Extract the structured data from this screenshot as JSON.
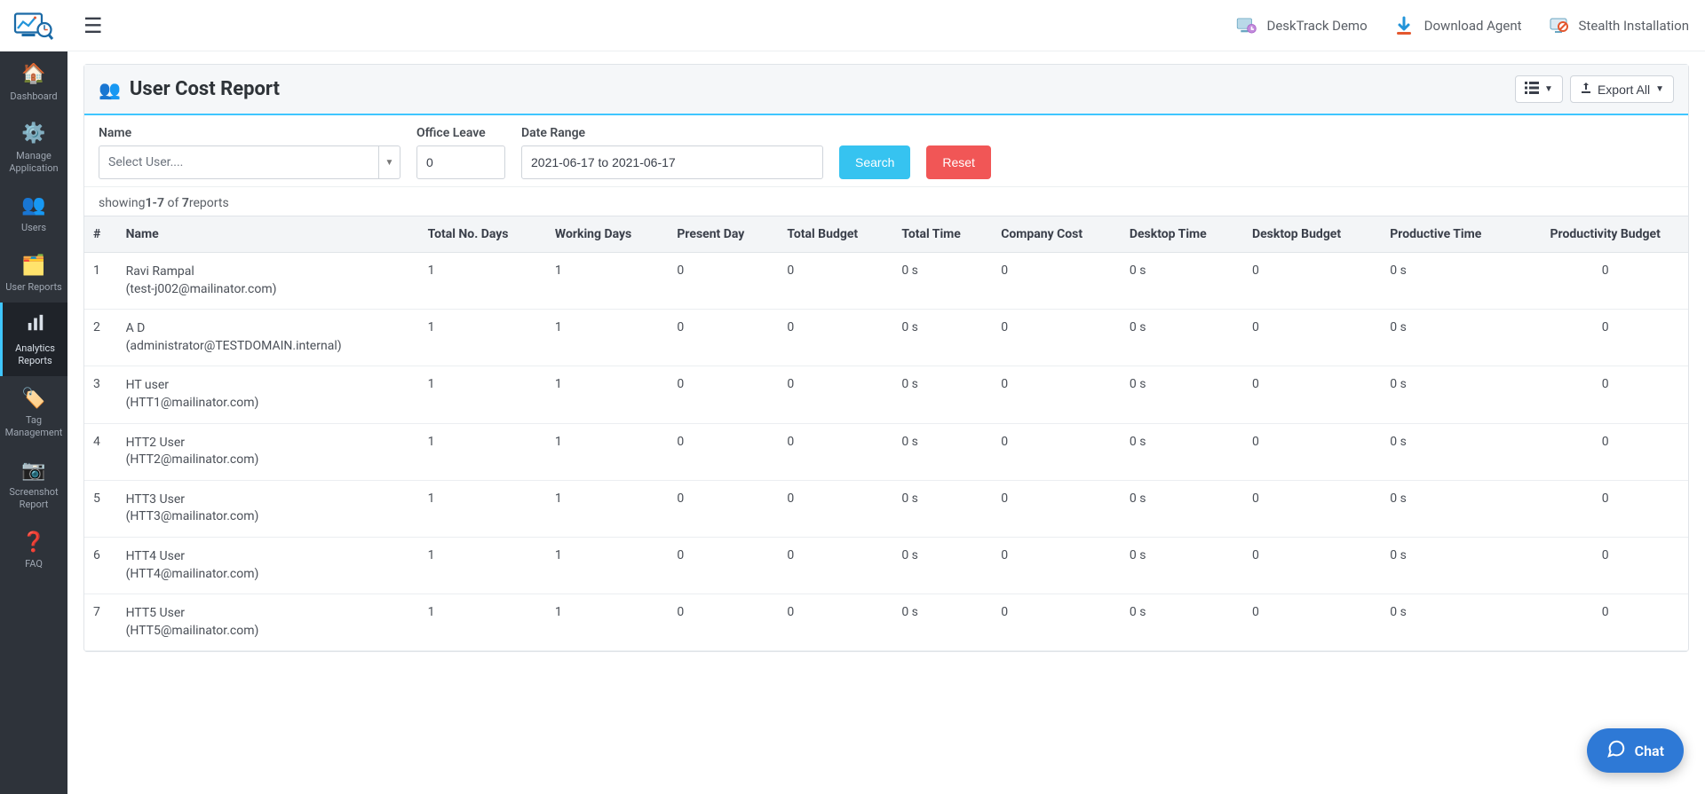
{
  "sidebar": {
    "items": [
      {
        "label": "Dashboard"
      },
      {
        "label": "Manage Application"
      },
      {
        "label": "Users"
      },
      {
        "label": "User Reports"
      },
      {
        "label": "Analytics Reports"
      },
      {
        "label": "Tag Management"
      },
      {
        "label": "Screenshot Report"
      },
      {
        "label": "FAQ"
      }
    ]
  },
  "topbar": {
    "demo_label": "DeskTrack Demo",
    "download_label": "Download Agent",
    "stealth_label": "Stealth Installation"
  },
  "panel": {
    "title": "User Cost Report",
    "export_label": "Export All"
  },
  "filters": {
    "name_label": "Name",
    "name_placeholder": "Select User....",
    "office_leave_label": "Office Leave",
    "office_leave_value": "0",
    "date_range_label": "Date Range",
    "date_range_value": "2021-06-17 to 2021-06-17",
    "search_label": "Search",
    "reset_label": "Reset"
  },
  "resultcount": {
    "prefix": "showing",
    "range": "1-7",
    "of": " of ",
    "total": "7",
    "suffix": "reports"
  },
  "table": {
    "columns": [
      "#",
      "Name",
      "Total No. Days",
      "Working Days",
      "Present Day",
      "Total Budget",
      "Total Time",
      "Company Cost",
      "Desktop Time",
      "Desktop Budget",
      "Productive Time",
      "Productivity Budget"
    ],
    "rows": [
      {
        "idx": "1",
        "name": "Ravi Rampal",
        "email": "(test-j002@mailinator.com)",
        "total_days": "1",
        "working_days": "1",
        "present_day": "0",
        "total_budget": "0",
        "total_time": "0 s",
        "company_cost": "0",
        "desktop_time": "0 s",
        "desktop_budget": "0",
        "productive_time": "0 s",
        "productivity_budget": "0"
      },
      {
        "idx": "2",
        "name": "A D",
        "email": "(administrator@TESTDOMAIN.internal)",
        "total_days": "1",
        "working_days": "1",
        "present_day": "0",
        "total_budget": "0",
        "total_time": "0 s",
        "company_cost": "0",
        "desktop_time": "0 s",
        "desktop_budget": "0",
        "productive_time": "0 s",
        "productivity_budget": "0"
      },
      {
        "idx": "3",
        "name": "HT user",
        "email": "(HTT1@mailinator.com)",
        "total_days": "1",
        "working_days": "1",
        "present_day": "0",
        "total_budget": "0",
        "total_time": "0 s",
        "company_cost": "0",
        "desktop_time": "0 s",
        "desktop_budget": "0",
        "productive_time": "0 s",
        "productivity_budget": "0"
      },
      {
        "idx": "4",
        "name": "HTT2 User",
        "email": "(HTT2@mailinator.com)",
        "total_days": "1",
        "working_days": "1",
        "present_day": "0",
        "total_budget": "0",
        "total_time": "0 s",
        "company_cost": "0",
        "desktop_time": "0 s",
        "desktop_budget": "0",
        "productive_time": "0 s",
        "productivity_budget": "0"
      },
      {
        "idx": "5",
        "name": "HTT3 User",
        "email": "(HTT3@mailinator.com)",
        "total_days": "1",
        "working_days": "1",
        "present_day": "0",
        "total_budget": "0",
        "total_time": "0 s",
        "company_cost": "0",
        "desktop_time": "0 s",
        "desktop_budget": "0",
        "productive_time": "0 s",
        "productivity_budget": "0"
      },
      {
        "idx": "6",
        "name": "HTT4 User",
        "email": "(HTT4@mailinator.com)",
        "total_days": "1",
        "working_days": "1",
        "present_day": "0",
        "total_budget": "0",
        "total_time": "0 s",
        "company_cost": "0",
        "desktop_time": "0 s",
        "desktop_budget": "0",
        "productive_time": "0 s",
        "productivity_budget": "0"
      },
      {
        "idx": "7",
        "name": "HTT5 User",
        "email": "(HTT5@mailinator.com)",
        "total_days": "1",
        "working_days": "1",
        "present_day": "0",
        "total_budget": "0",
        "total_time": "0 s",
        "company_cost": "0",
        "desktop_time": "0 s",
        "desktop_budget": "0",
        "productive_time": "0 s",
        "productivity_budget": "0"
      }
    ]
  },
  "chat": {
    "label": "Chat"
  }
}
